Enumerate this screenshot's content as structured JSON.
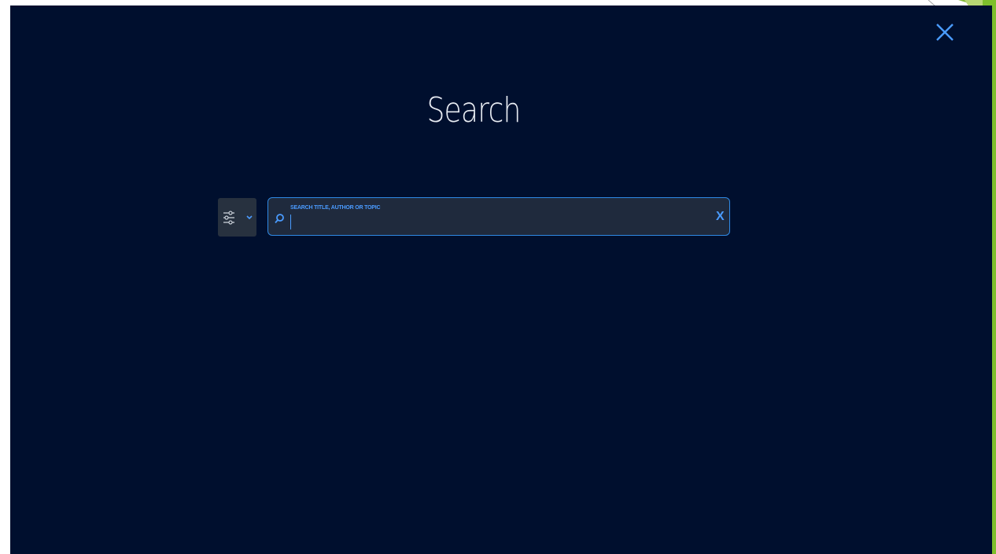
{
  "overlay": {
    "title": "Search",
    "close_icon": "close-icon"
  },
  "filter": {
    "icon": "sliders-icon",
    "dropdown_icon": "chevron-down-icon"
  },
  "search": {
    "label": "SEARCH TITLE, AUTHOR OR TOPIC",
    "value": "",
    "icon": "search-icon",
    "clear_label": "X"
  },
  "colors": {
    "background": "#000f2e",
    "accent": "#4a9bff",
    "frame_green": "#7cb342"
  }
}
